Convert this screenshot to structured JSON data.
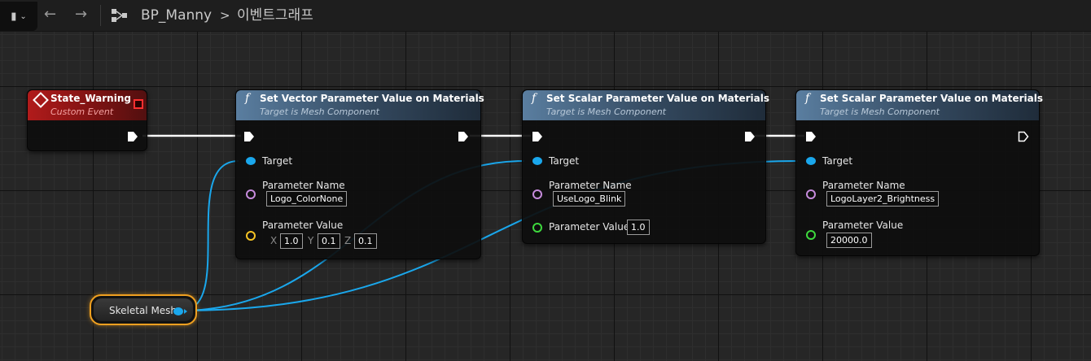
{
  "topbar": {
    "blueprint_name": "BP_Manny",
    "graph_name": "이벤트그래프",
    "separator": ">",
    "icons": [
      "bookmark-icon",
      "back-arrow-icon",
      "forward-arrow-icon",
      "graph-icon"
    ]
  },
  "colors": {
    "object_pin": "#1aa7ec",
    "name_pin": "#c68bdc",
    "vector_pin": "#f5c324",
    "float_pin": "#3ed93e",
    "exec_pin": "#ffffff",
    "event_header": "#b11b1b",
    "function_header": "#5a7ea0",
    "selection": "#f0a020"
  },
  "event_node": {
    "title": "State_Warning",
    "subtitle": "Custom Event"
  },
  "node1": {
    "title": "Set Vector Parameter Value on Materials",
    "subtitle": "Target is Mesh Component",
    "target_label": "Target",
    "param_name_label": "Parameter Name",
    "param_name_value": "Logo_ColorNone",
    "param_value_label": "Parameter Value",
    "x_label": "X",
    "x_value": "1.0",
    "y_label": "Y",
    "y_value": "0.1",
    "z_label": "Z",
    "z_value": "0.1"
  },
  "node2": {
    "title": "Set Scalar Parameter Value on Materials",
    "subtitle": "Target is Mesh Component",
    "target_label": "Target",
    "param_name_label": "Parameter Name",
    "param_name_value": "UseLogo_Blink",
    "param_value_label": "Parameter Value",
    "param_value": "1.0"
  },
  "node3": {
    "title": "Set Scalar Parameter Value on Materials",
    "subtitle": "Target is Mesh Component",
    "target_label": "Target",
    "param_name_label": "Parameter Name",
    "param_name_value": "LogoLayer2_Brightness",
    "param_value_label": "Parameter Value",
    "param_value": "20000.0"
  },
  "mesh_node": {
    "label": "Skeletal Mesh"
  }
}
